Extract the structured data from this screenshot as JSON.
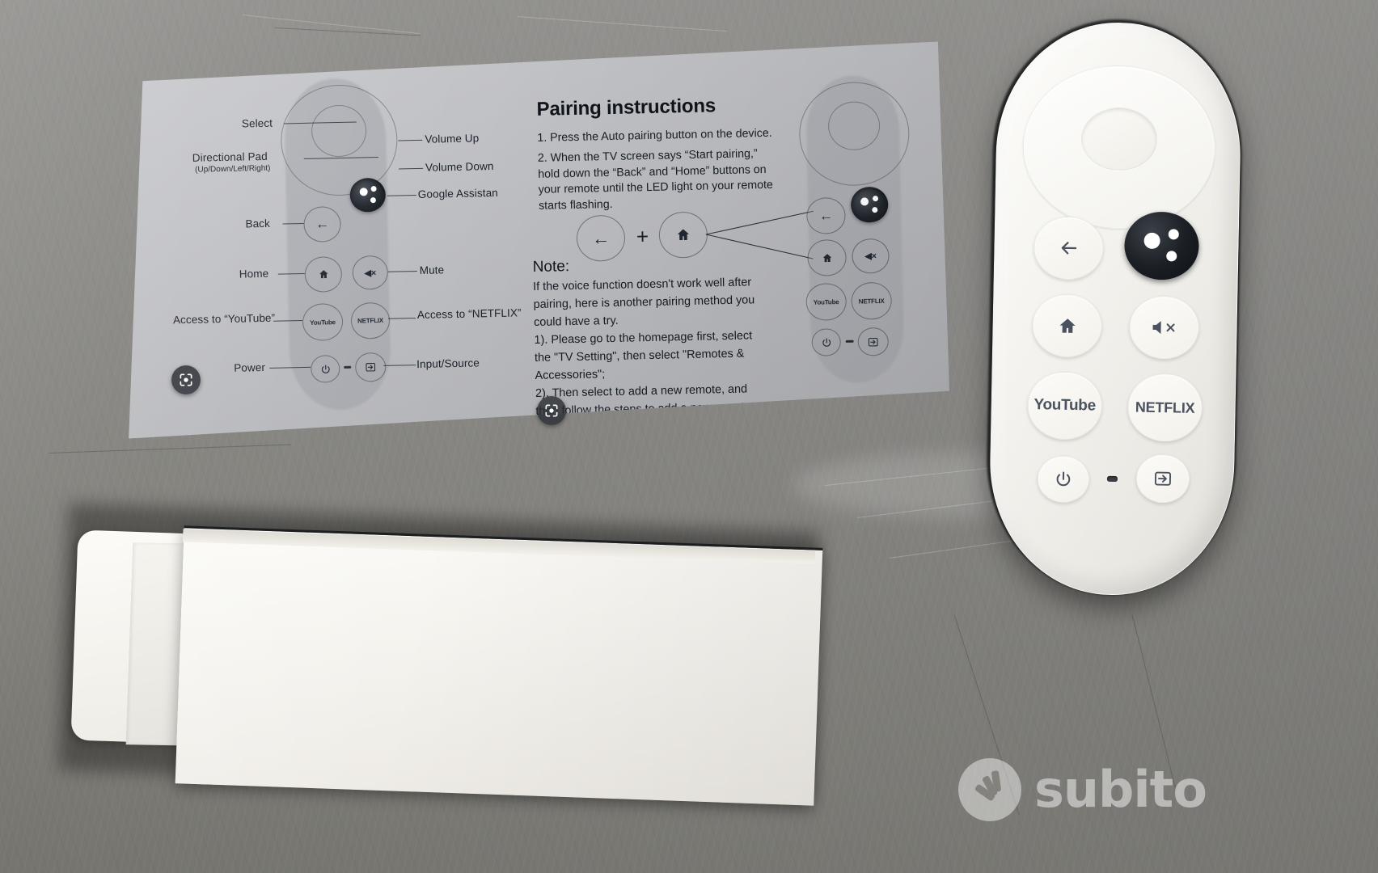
{
  "photo": {
    "subject": "Google Chromecast TV voice remote with instruction leaflet and retail box on a grey desk",
    "watermark": {
      "brand": "subito",
      "icon": "subito-burst-icon"
    }
  },
  "leaflet": {
    "diagram_left": {
      "labels": [
        {
          "id": "select",
          "text": "Select"
        },
        {
          "id": "dpad",
          "text": "Directional Pad"
        },
        {
          "id": "dpad_sub",
          "text": "(Up/Down/Left/Right)"
        },
        {
          "id": "back",
          "text": "Back"
        },
        {
          "id": "home",
          "text": "Home"
        },
        {
          "id": "youtube",
          "text": "Access to “YouTube”"
        },
        {
          "id": "power",
          "text": "Power"
        },
        {
          "id": "volume_up",
          "text": "Volume Up"
        },
        {
          "id": "volume_down",
          "text": "Volume Down"
        },
        {
          "id": "assistant",
          "text": "Google Assistan"
        },
        {
          "id": "mute",
          "text": "Mute"
        },
        {
          "id": "netflix",
          "text": "Access to “NETFLIX”"
        },
        {
          "id": "input",
          "text": "Input/Source"
        }
      ],
      "button_glyphs": {
        "back": "←",
        "home": "⌂",
        "youtube": "YouTube",
        "netflix": "NETFLIX",
        "power": "⏻",
        "mute": "◀×",
        "input": "⇥"
      }
    },
    "pairing": {
      "title": "Pairing instructions",
      "steps": [
        {
          "num": "1.",
          "text": "Press the Auto pairing button on the device."
        },
        {
          "num": "2.",
          "text": "When the TV screen says “Start pairing,” hold down the “Back” and “Home” buttons on your remote until the LED light on your remote starts flashing."
        }
      ],
      "combo": {
        "left": "←",
        "operator": "+",
        "right": "⌂"
      }
    },
    "note": {
      "title": "Note:",
      "lines": [
        "If the voice function doesn't work well after",
        "pairing, here is another pairing method you",
        "could have a try.",
        "1). Please go to the homepage first, select",
        "the \"TV Setting\", then select \"Remotes &",
        "Accessories\";",
        "2). Then select to add a new remote, and",
        "then follow the steps to add a new remote."
      ]
    },
    "diagram_right": {
      "buttons": [
        "←",
        "⌂",
        "YouTube",
        "⏻",
        "NETFLIX",
        "⇥"
      ],
      "mute_glyph": "◀×"
    }
  },
  "remote": {
    "buttons": [
      {
        "id": "back",
        "label": "←",
        "type": "glyph"
      },
      {
        "id": "assistant",
        "label": "",
        "type": "assistant-dots"
      },
      {
        "id": "home",
        "label": "⌂",
        "type": "glyph"
      },
      {
        "id": "mute",
        "label": "◀×",
        "type": "glyph"
      },
      {
        "id": "youtube",
        "label": "YouTube",
        "type": "text"
      },
      {
        "id": "netflix",
        "label": "NETFLIX",
        "type": "text"
      },
      {
        "id": "power",
        "label": "⏻",
        "type": "glyph"
      },
      {
        "id": "input",
        "label": "⇥",
        "type": "glyph"
      }
    ]
  },
  "colors": {
    "desk": "#8d8c8a",
    "paper": "#c0c1c5",
    "remote_white": "#f7f5f1",
    "assistant_black": "#16191e",
    "ink": "#1c2029"
  }
}
